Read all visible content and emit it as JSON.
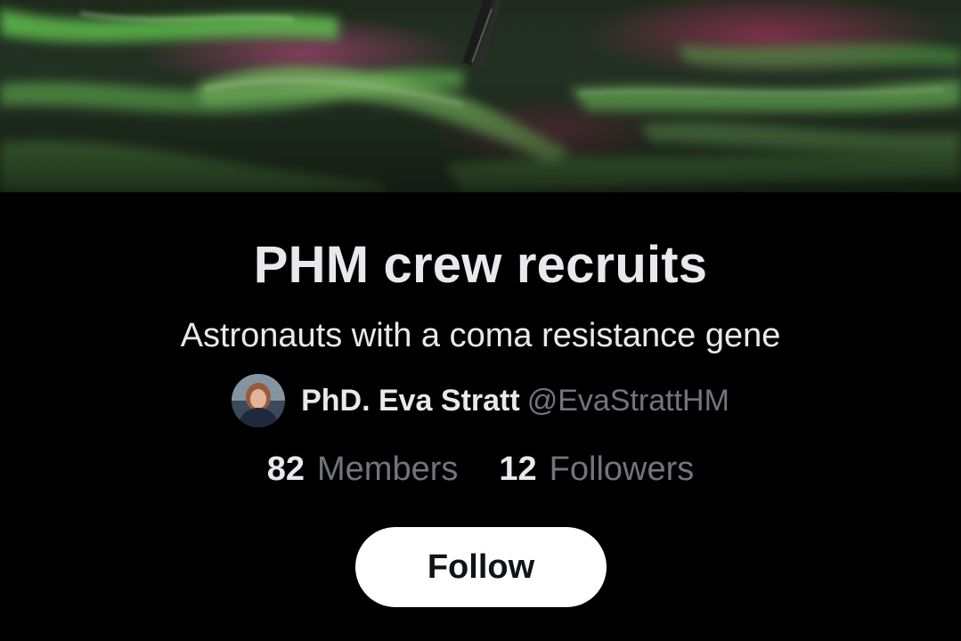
{
  "community": {
    "banner_alt": "aurora-banner-image",
    "title": "PHM crew recruits",
    "description": "Astronauts with a coma resistance gene"
  },
  "owner": {
    "name": "PhD. Eva Stratt",
    "handle": "@EvaStrattHM"
  },
  "stats": {
    "members_count": "82",
    "members_label": "Members",
    "followers_count": "12",
    "followers_label": "Followers"
  },
  "actions": {
    "follow_label": "Follow"
  },
  "colors": {
    "background": "#000000",
    "primary_text": "#e7e9ea",
    "secondary_text": "#71767b",
    "button_bg": "#ffffff",
    "button_text": "#0f1419"
  }
}
